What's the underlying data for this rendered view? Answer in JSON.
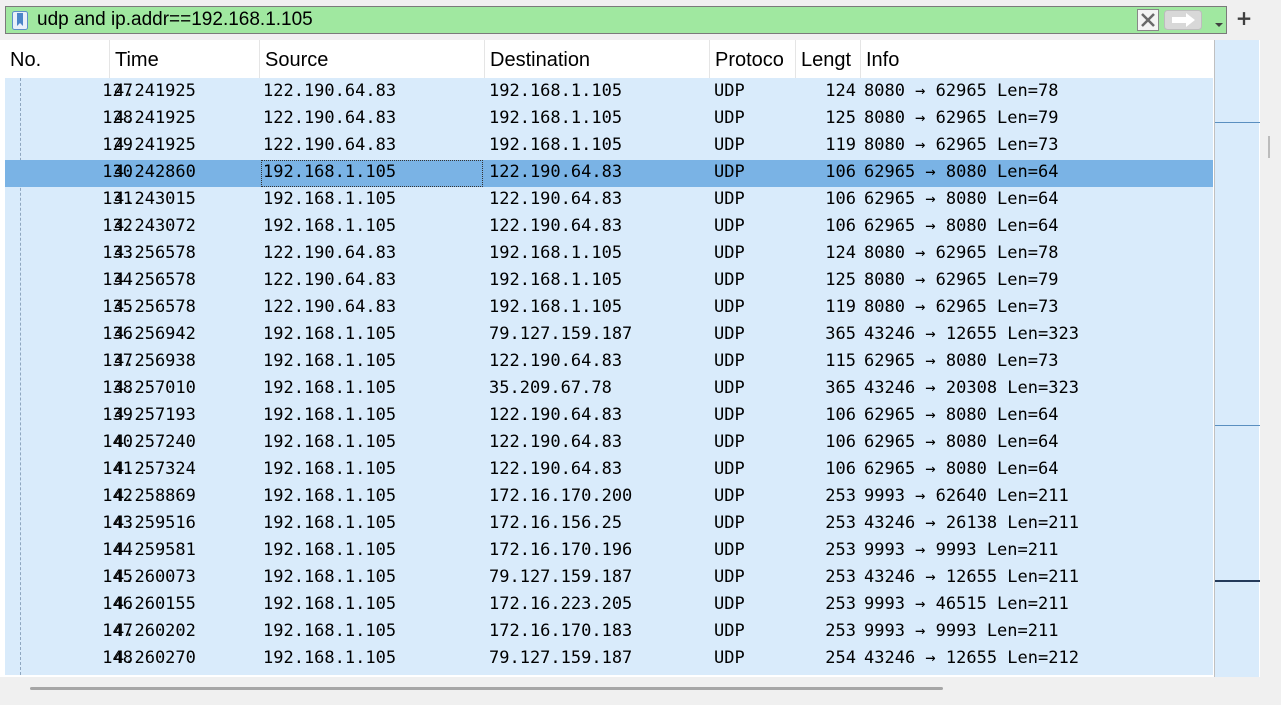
{
  "filter": {
    "value": "udp and ip.addr==192.168.1.105"
  },
  "icons": {
    "bookmark": "bookmark-icon",
    "clear": "clear-filter-icon",
    "apply": "apply-arrow-icon",
    "dropdown": "chevron-down-icon",
    "add": "plus-icon"
  },
  "add_button_label": "+",
  "columns": {
    "no": "No.",
    "time": "Time",
    "source": "Source",
    "destination": "Destination",
    "protocol": "Protoco",
    "length": "Lengt",
    "info": "Info"
  },
  "colors": {
    "filter_valid": "#a0e8a0",
    "row_bg": "#d9ebfb",
    "selected_bg": "#7ab3e5"
  },
  "selected_packet": "130",
  "packets": [
    {
      "no": "127",
      "time": "4.241925",
      "source": "122.190.64.83",
      "destination": "192.168.1.105",
      "protocol": "UDP",
      "length": "124",
      "info": "8080 → 62965 Len=78"
    },
    {
      "no": "128",
      "time": "4.241925",
      "source": "122.190.64.83",
      "destination": "192.168.1.105",
      "protocol": "UDP",
      "length": "125",
      "info": "8080 → 62965 Len=79"
    },
    {
      "no": "129",
      "time": "4.241925",
      "source": "122.190.64.83",
      "destination": "192.168.1.105",
      "protocol": "UDP",
      "length": "119",
      "info": "8080 → 62965 Len=73"
    },
    {
      "no": "130",
      "time": "4.242860",
      "source": "192.168.1.105",
      "destination": "122.190.64.83",
      "protocol": "UDP",
      "length": "106",
      "info": "62965 → 8080 Len=64"
    },
    {
      "no": "131",
      "time": "4.243015",
      "source": "192.168.1.105",
      "destination": "122.190.64.83",
      "protocol": "UDP",
      "length": "106",
      "info": "62965 → 8080 Len=64"
    },
    {
      "no": "132",
      "time": "4.243072",
      "source": "192.168.1.105",
      "destination": "122.190.64.83",
      "protocol": "UDP",
      "length": "106",
      "info": "62965 → 8080 Len=64"
    },
    {
      "no": "133",
      "time": "4.256578",
      "source": "122.190.64.83",
      "destination": "192.168.1.105",
      "protocol": "UDP",
      "length": "124",
      "info": "8080 → 62965 Len=78"
    },
    {
      "no": "134",
      "time": "4.256578",
      "source": "122.190.64.83",
      "destination": "192.168.1.105",
      "protocol": "UDP",
      "length": "125",
      "info": "8080 → 62965 Len=79"
    },
    {
      "no": "135",
      "time": "4.256578",
      "source": "122.190.64.83",
      "destination": "192.168.1.105",
      "protocol": "UDP",
      "length": "119",
      "info": "8080 → 62965 Len=73"
    },
    {
      "no": "136",
      "time": "4.256942",
      "source": "192.168.1.105",
      "destination": "79.127.159.187",
      "protocol": "UDP",
      "length": "365",
      "info": "43246 → 12655 Len=323"
    },
    {
      "no": "137",
      "time": "4.256938",
      "source": "192.168.1.105",
      "destination": "122.190.64.83",
      "protocol": "UDP",
      "length": "115",
      "info": "62965 → 8080 Len=73"
    },
    {
      "no": "138",
      "time": "4.257010",
      "source": "192.168.1.105",
      "destination": "35.209.67.78",
      "protocol": "UDP",
      "length": "365",
      "info": "43246 → 20308 Len=323"
    },
    {
      "no": "139",
      "time": "4.257193",
      "source": "192.168.1.105",
      "destination": "122.190.64.83",
      "protocol": "UDP",
      "length": "106",
      "info": "62965 → 8080 Len=64"
    },
    {
      "no": "140",
      "time": "4.257240",
      "source": "192.168.1.105",
      "destination": "122.190.64.83",
      "protocol": "UDP",
      "length": "106",
      "info": "62965 → 8080 Len=64"
    },
    {
      "no": "141",
      "time": "4.257324",
      "source": "192.168.1.105",
      "destination": "122.190.64.83",
      "protocol": "UDP",
      "length": "106",
      "info": "62965 → 8080 Len=64"
    },
    {
      "no": "142",
      "time": "4.258869",
      "source": "192.168.1.105",
      "destination": "172.16.170.200",
      "protocol": "UDP",
      "length": "253",
      "info": "9993 → 62640 Len=211"
    },
    {
      "no": "143",
      "time": "4.259516",
      "source": "192.168.1.105",
      "destination": "172.16.156.25",
      "protocol": "UDP",
      "length": "253",
      "info": "43246 → 26138 Len=211"
    },
    {
      "no": "144",
      "time": "4.259581",
      "source": "192.168.1.105",
      "destination": "172.16.170.196",
      "protocol": "UDP",
      "length": "253",
      "info": "9993 → 9993 Len=211"
    },
    {
      "no": "145",
      "time": "4.260073",
      "source": "192.168.1.105",
      "destination": "79.127.159.187",
      "protocol": "UDP",
      "length": "253",
      "info": "43246 → 12655 Len=211"
    },
    {
      "no": "146",
      "time": "4.260155",
      "source": "192.168.1.105",
      "destination": "172.16.223.205",
      "protocol": "UDP",
      "length": "253",
      "info": "9993 → 46515 Len=211"
    },
    {
      "no": "147",
      "time": "4.260202",
      "source": "192.168.1.105",
      "destination": "172.16.170.183",
      "protocol": "UDP",
      "length": "253",
      "info": "9993 → 9993 Len=211"
    },
    {
      "no": "148",
      "time": "4.260270",
      "source": "192.168.1.105",
      "destination": "79.127.159.187",
      "protocol": "UDP",
      "length": "254",
      "info": "43246 → 12655 Len=212"
    }
  ]
}
